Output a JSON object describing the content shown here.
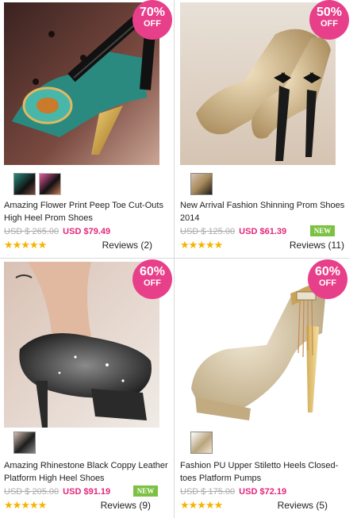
{
  "products": [
    {
      "discount_pct": "70%",
      "discount_label": "OFF",
      "title": "Amazing Flower Print Peep Toe Cut-Outs High Heel Prom Shoes",
      "old_price": "USD $ 265.00",
      "price": "USD $79.49",
      "is_new": false,
      "stars": "★★★★★",
      "reviews": "Reviews (2)",
      "thumbs": 2,
      "image": "shoe-photo"
    },
    {
      "discount_pct": "50%",
      "discount_label": "OFF",
      "title": "New Arrival Fashion Shinning Prom Shoes 2014",
      "old_price": "USD $ 125.00",
      "price": "USD $61.39",
      "is_new": true,
      "new_label": "NEW",
      "stars": "★★★★★",
      "reviews": "Reviews (11)",
      "thumbs": 1,
      "image": "shoe-photo"
    },
    {
      "discount_pct": "60%",
      "discount_label": "OFF",
      "title": "Amazing Rhinestone Black Coppy Leather Platform High Heel Shoes",
      "old_price": "USD $ 205.00",
      "price": "USD $91.19",
      "is_new": true,
      "new_label": "NEW",
      "stars": "★★★★★",
      "reviews": "Reviews (9)",
      "thumbs": 1,
      "image": "shoe-photo"
    },
    {
      "discount_pct": "60%",
      "discount_label": "OFF",
      "title": "Fashion PU Upper Stiletto Heels Closed-toes Platform Pumps",
      "old_price": "USD $ 175.00",
      "price": "USD $72.19",
      "is_new": false,
      "stars": "★★★★★",
      "reviews": "Reviews (5)",
      "thumbs": 1,
      "image": "shoe-photo"
    }
  ],
  "colors": {
    "badge": "#e83f8a",
    "sale_price": "#e4267b",
    "new_tag": "#7cc142",
    "stars": "#f5b400"
  }
}
